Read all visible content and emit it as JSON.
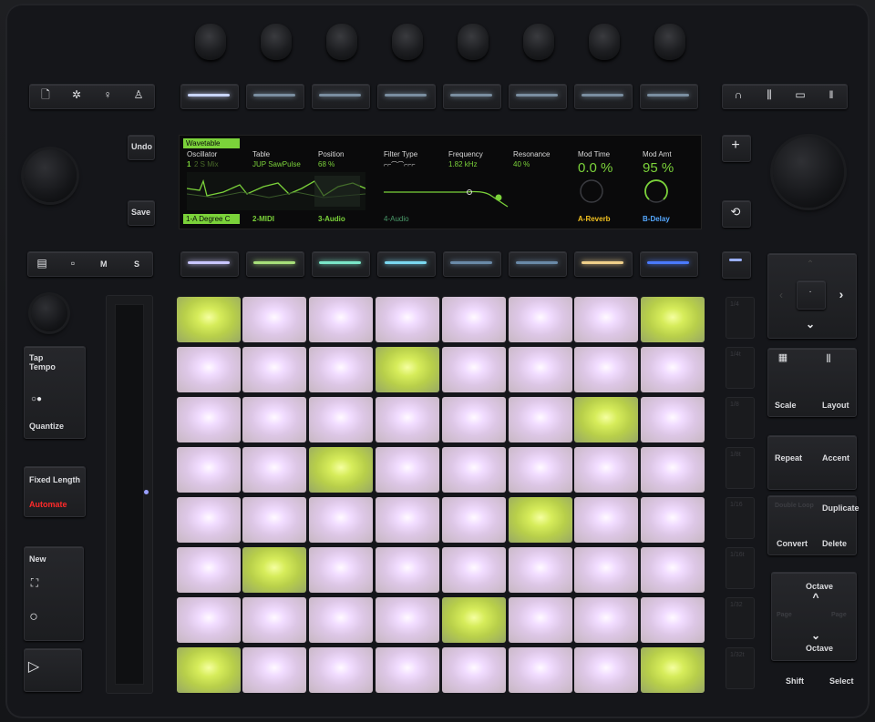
{
  "colors": {
    "pad_white": "#e4d0ea",
    "pad_green": "#cde35a",
    "screen_green": "#7bd23a",
    "screen_yellow": "#f0c020",
    "screen_blue": "#55a8ff",
    "automate_red": "#ff2a2a",
    "screen_bg": "#0a0a0b"
  },
  "left_buttons": {
    "undo": "Undo",
    "save": "Save",
    "mute": "M",
    "solo": "S",
    "tap": "Tap",
    "tempo": "Tempo",
    "quantize": "Quantize",
    "fixed_length": "Fixed Length",
    "automate": "Automate",
    "new": "New"
  },
  "right_buttons": {
    "scale": "Scale",
    "layout": "Layout",
    "repeat": "Repeat",
    "accent": "Accent",
    "double_loop": "Double Loop",
    "duplicate": "Duplicate",
    "convert": "Convert",
    "delete": "Delete",
    "octave_up": "Octave",
    "octave_down": "Octave",
    "page": "Page",
    "shift": "Shift",
    "select": "Select"
  },
  "scene_buttons": [
    "1/4",
    "1/4t",
    "1/8",
    "1/8t",
    "1/16",
    "1/16t",
    "1/32",
    "1/32t"
  ],
  "screen": {
    "device_name": "Wavetable",
    "columns": [
      {
        "title": "Oscillator",
        "value_a": "1",
        "value_b": "2 S Mix"
      },
      {
        "title": "Table",
        "value": "JUP SawPulse"
      },
      {
        "title": "Position",
        "value": "68 %"
      },
      {
        "title": "Filter Type",
        "value": "⌐⌐⌒⌒⌐⌐⌐"
      },
      {
        "title": "Frequency",
        "value": "1.82 kHz"
      },
      {
        "title": "Resonance",
        "value": "40 %"
      },
      {
        "title": "Mod Time",
        "value": "0.0 %"
      },
      {
        "title": "Mod Amt",
        "value": "95 %"
      }
    ],
    "tracks": [
      "1-A Degree C",
      "2-MIDI",
      "3-Audio",
      "4-Audio",
      "",
      "",
      "A-Reverb",
      "B-Delay"
    ]
  },
  "upper_led_colors": [
    "#c8d4ff",
    "#7a8ea0",
    "#7a8ea0",
    "#7a8ea0",
    "#7a8ea0",
    "#7a8ea0",
    "#7a8ea0",
    "#7a8ea0"
  ],
  "lower_led_colors": [
    "#c8c6ff",
    "#a8e07a",
    "#7ae6c8",
    "#7ad8f0",
    "#6a8aa8",
    "#6a8aa8",
    "#f0d08a",
    "#4a7aff"
  ],
  "pad_grid": [
    [
      1,
      0,
      0,
      0,
      0,
      0,
      0,
      1
    ],
    [
      0,
      0,
      0,
      1,
      0,
      0,
      0,
      0
    ],
    [
      0,
      0,
      0,
      0,
      0,
      0,
      1,
      0
    ],
    [
      0,
      0,
      1,
      0,
      0,
      0,
      0,
      0
    ],
    [
      0,
      0,
      0,
      0,
      0,
      1,
      0,
      0
    ],
    [
      0,
      1,
      0,
      0,
      0,
      0,
      0,
      0
    ],
    [
      0,
      0,
      0,
      0,
      1,
      0,
      0,
      0
    ],
    [
      1,
      0,
      0,
      0,
      0,
      0,
      0,
      1
    ]
  ]
}
